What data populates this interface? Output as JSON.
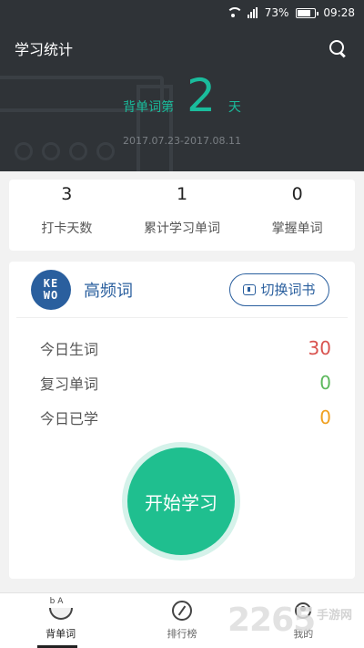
{
  "status_bar": {
    "battery": "73%",
    "time": "09:28"
  },
  "header": {
    "title": "学习统计",
    "days_prefix": "背单词第",
    "days_count": "2",
    "days_suffix": "天",
    "date_range": "2017.07.23-2017.08.11"
  },
  "stats": [
    {
      "value": "3",
      "label": "打卡天数"
    },
    {
      "value": "1",
      "label": "累计学习单词"
    },
    {
      "value": "0",
      "label": "掌握单词"
    }
  ],
  "book": {
    "logo_text": "KE WO",
    "name": "高频词",
    "switch_label": "切换词书"
  },
  "word_stats": [
    {
      "label": "今日生词",
      "value": "30",
      "color": "#d9534f"
    },
    {
      "label": "复习单词",
      "value": "0",
      "color": "#5cb85c"
    },
    {
      "label": "今日已学",
      "value": "0",
      "color": "#f0a020"
    }
  ],
  "start_button": "开始学习",
  "nav": [
    {
      "label": "背单词",
      "icon": "bowl-icon",
      "active": true
    },
    {
      "label": "排行榜",
      "icon": "compass-icon",
      "active": false
    },
    {
      "label": "我的",
      "icon": "person-icon",
      "active": false
    }
  ],
  "watermark": {
    "main": "2265",
    "small": "手游网"
  },
  "colors": {
    "accent": "#1fbf8f",
    "brand_blue": "#2a5f9e",
    "header_bg": "#2f3337"
  }
}
